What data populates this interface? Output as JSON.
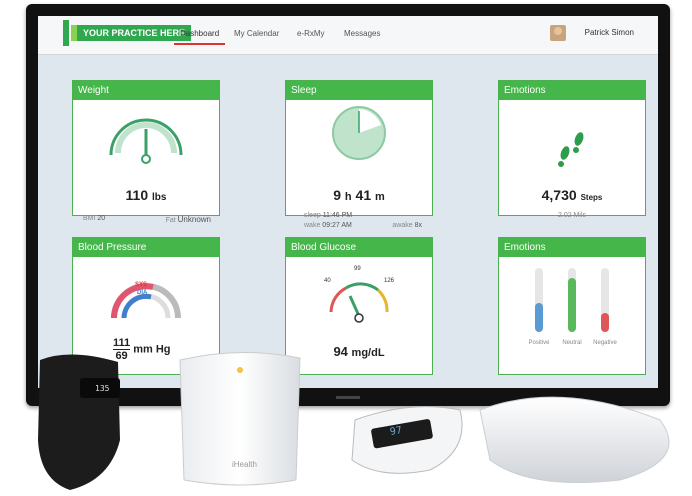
{
  "nav": {
    "logo": "YOUR PRACTICE HERE",
    "tabs": [
      "Dashboard",
      "My Calendar",
      "e-RxMy",
      "Messages"
    ],
    "user": "Patrick Simon"
  },
  "cards": {
    "weight": {
      "title": "Weight",
      "value": "110",
      "unit": "lbs",
      "bmi_label": "BMI",
      "bmi": "20",
      "fat_label": "Fat",
      "fat": "Unknown"
    },
    "sleep": {
      "title": "Sleep",
      "hours": "9",
      "h": "h",
      "minutes": "41",
      "m": "m",
      "sleep_label": "sleep",
      "sleep_time": "11:46 PM",
      "wake_label": "wake",
      "wake_time": "09:27 AM",
      "awake_label": "awake",
      "awake_count": "8x"
    },
    "steps": {
      "title": "Emotions",
      "value": "4,730",
      "unit": "Steps",
      "distance": "2.02 Mils"
    },
    "blood_pressure": {
      "title": "Blood Pressure",
      "sys_label": "SYS",
      "dia_label": "DIA",
      "sys": "111",
      "dia": "69",
      "unit": "mm Hg"
    },
    "glucose": {
      "title": "Blood Glucose",
      "low": "40",
      "mid": "99",
      "high": "126",
      "value": "94",
      "unit": "mg/dL"
    },
    "emotions": {
      "title": "Emotions",
      "labels": [
        "Positive",
        "Neutral",
        "Negative"
      ],
      "levels": [
        0.45,
        0.85,
        0.3
      ],
      "colors": [
        "#5b9bd5",
        "#5cb85c",
        "#e05555"
      ]
    }
  },
  "devices": {
    "monitor_brand": "iHealth",
    "watch_display": "135",
    "oximeter_display": "97"
  }
}
